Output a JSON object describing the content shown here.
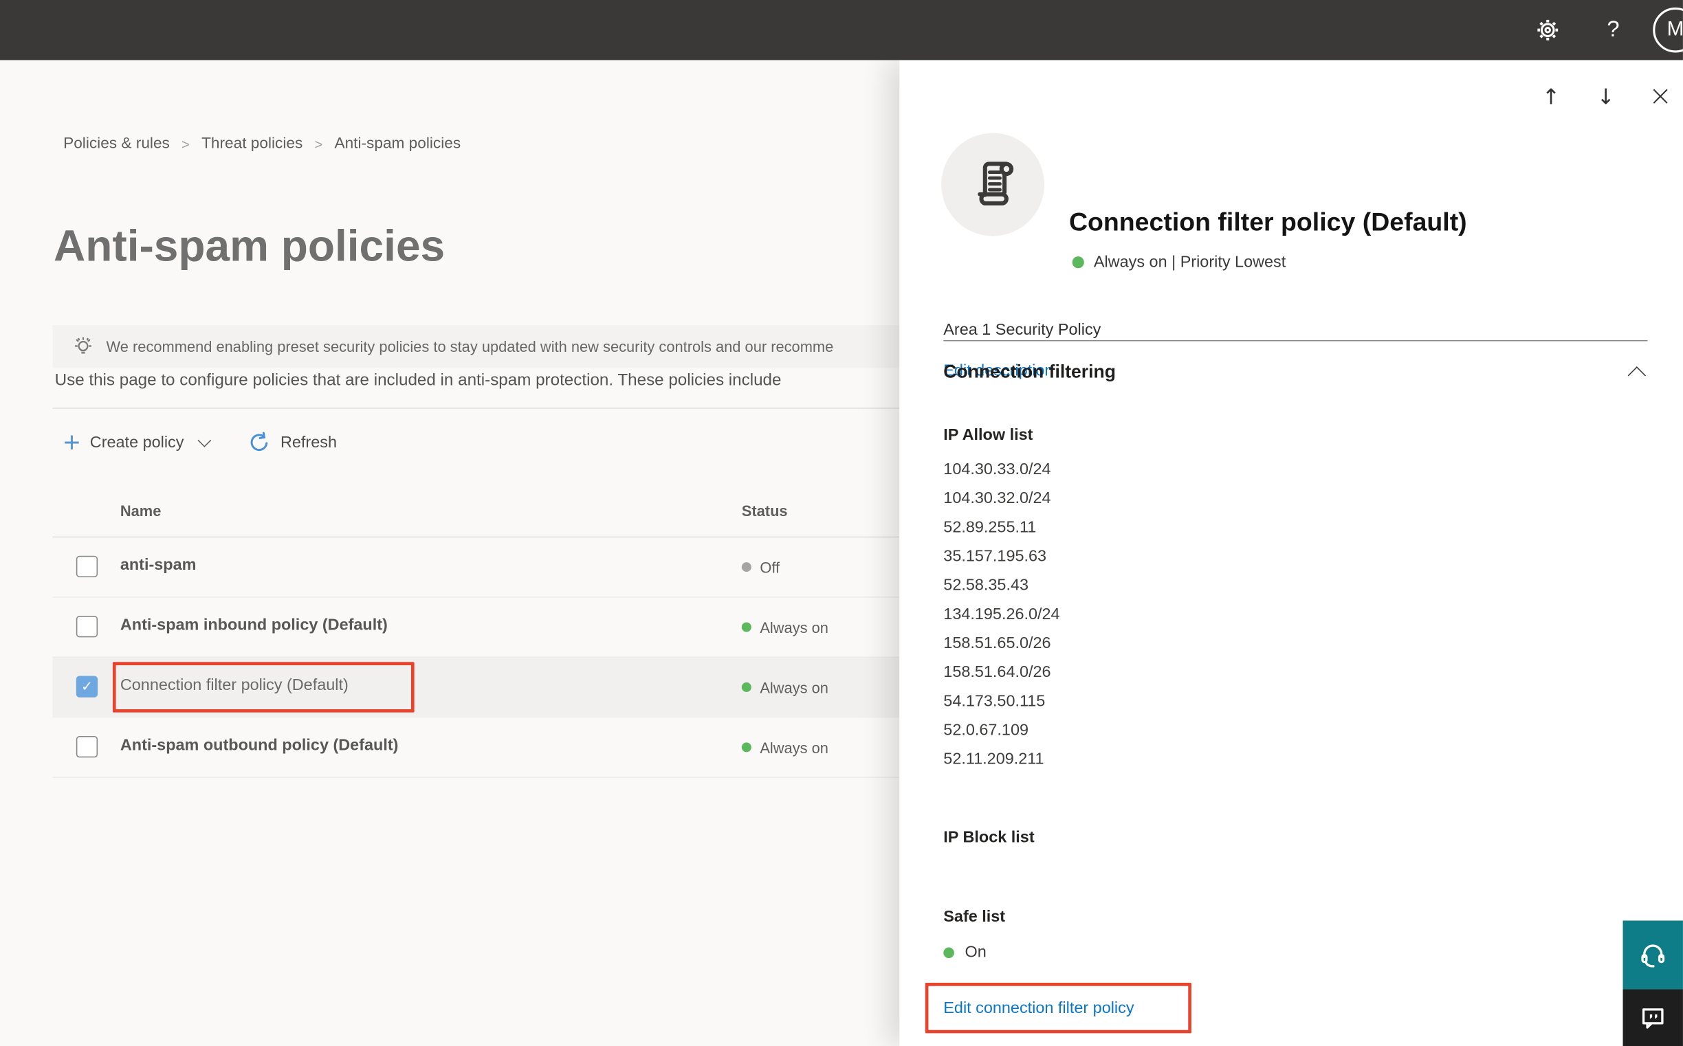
{
  "topbar": {
    "help_label": "?",
    "avatar_initial": "M"
  },
  "breadcrumb": {
    "separator": ">",
    "items": [
      "Policies & rules",
      "Threat policies",
      "Anti-spam policies"
    ]
  },
  "page": {
    "title": "Anti-spam policies",
    "banner_text": "We recommend enabling preset security policies to stay updated with new security controls and our recomme",
    "description": "Use this page to configure policies that are included in anti-spam protection. These policies include"
  },
  "toolbar": {
    "create_policy_label": "Create policy",
    "refresh_label": "Refresh"
  },
  "table": {
    "columns": [
      "Name",
      "Status"
    ],
    "rows": [
      {
        "name": "anti-spam",
        "status": "Off",
        "status_kind": "off",
        "selected": false
      },
      {
        "name": "Anti-spam inbound policy (Default)",
        "status": "Always on",
        "status_kind": "on",
        "selected": false
      },
      {
        "name": "Connection filter policy (Default)",
        "status": "Always on",
        "status_kind": "on",
        "selected": true,
        "highlighted_red_outline": true
      },
      {
        "name": "Anti-spam outbound policy (Default)",
        "status": "Always on",
        "status_kind": "on",
        "selected": false
      }
    ]
  },
  "panel": {
    "nav": {
      "up": "↑",
      "down": "↓",
      "close": "×"
    },
    "title": "Connection filter policy (Default)",
    "status_line": "Always on | Priority Lowest",
    "description": "Area 1 Security Policy",
    "edit_description_label": "Edit description",
    "section_title": "Connection filtering",
    "ip_allow_heading": "IP Allow list",
    "ip_allow_list": [
      "104.30.33.0/24",
      "104.30.32.0/24",
      "52.89.255.11",
      "35.157.195.63",
      "52.58.35.43",
      "134.195.26.0/24",
      "158.51.65.0/26",
      "158.51.64.0/26",
      "54.173.50.115",
      "52.0.67.109",
      "52.11.209.211"
    ],
    "ip_block_heading": "IP Block list",
    "safe_list_heading": "Safe list",
    "safe_list_status": "On",
    "edit_link_label": "Edit connection filter policy",
    "checkmark": "✓"
  },
  "icons": {
    "gear-icon": "settings gear (svg)",
    "help-icon": "question mark",
    "avatar": "circle with initial",
    "lightbulb-icon": "recommendation lightbulb (svg)",
    "plus-icon": "+",
    "chevron-down-icon": "css chevron",
    "refresh-icon": "circular arrow (svg)",
    "checkbox": "square toggle",
    "checkmark-icon": "✓",
    "up-arrow-icon": "↑",
    "down-arrow-icon": "↓",
    "close-icon": "×",
    "scroll-icon": "policy scroll (svg)",
    "chevron-up-icon": "css chevron",
    "status-dot": "colored circle",
    "headset-icon": "support headset (svg)",
    "feedback-icon": "speech bubble with quotes (svg)"
  },
  "colors": {
    "topbar_bg": "#3a3938",
    "link_blue": "#0b76c8",
    "selected_checkbox_blue": "#6fa8e0",
    "status_on_green": "#5cb85c",
    "status_off_gray": "#a6a4a2",
    "highlight_red": "#e8432d",
    "support_teal": "#0e7d87",
    "feedback_dark": "#1f1e1e",
    "banner_bg": "#f3f2f1",
    "selected_row_bg": "#f1f0ef"
  }
}
